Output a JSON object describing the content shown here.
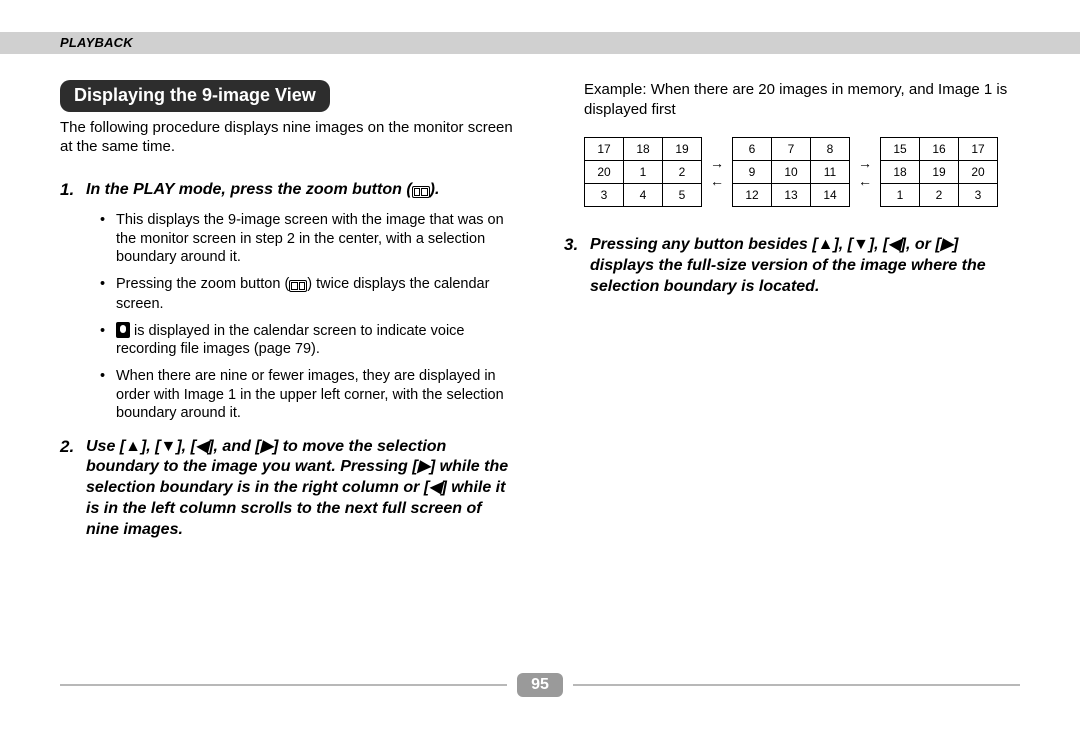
{
  "header": {
    "section": "PLAYBACK"
  },
  "title": "Displaying the 9-image View",
  "intro": "The following procedure displays nine images on the monitor screen at the same time.",
  "step1": {
    "num": "1.",
    "text_a": "In the PLAY mode, press the zoom button (",
    "text_b": ")."
  },
  "bullets": {
    "b1": "This displays the 9-image screen with the image that was on the monitor screen in step 2 in the center, with a selection boundary around it.",
    "b2_a": "Pressing the zoom button (",
    "b2_b": ") twice displays the calendar screen.",
    "b3": " is displayed in the calendar screen to indicate voice recording file images (page 79).",
    "b4": "When there are nine or fewer images, they are displayed in order with Image 1 in the upper left corner, with the selection boundary around it."
  },
  "step2": {
    "num": "2.",
    "text": "Use [▲], [▼], [◀], and [▶] to move the selection boundary to the image you want. Pressing [▶] while the selection boundary is in the right column or [◀] while it is in the left column scrolls to the next full screen of nine images."
  },
  "example": {
    "label": "Example:",
    "text": "When there are 20 images in memory, and Image 1 is displayed first"
  },
  "grids": {
    "g1": [
      [
        "17",
        "18",
        "19"
      ],
      [
        "20",
        "1",
        "2"
      ],
      [
        "3",
        "4",
        "5"
      ]
    ],
    "g2": [
      [
        "6",
        "7",
        "8"
      ],
      [
        "9",
        "10",
        "11"
      ],
      [
        "12",
        "13",
        "14"
      ]
    ],
    "g3": [
      [
        "15",
        "16",
        "17"
      ],
      [
        "18",
        "19",
        "20"
      ],
      [
        "1",
        "2",
        "3"
      ]
    ]
  },
  "arrows": {
    "right": "→",
    "left": "←"
  },
  "step3": {
    "num": "3.",
    "text": "Pressing any button besides [▲], [▼], [◀], or [▶] displays the full-size version of the image where the selection boundary is located."
  },
  "page": "95"
}
